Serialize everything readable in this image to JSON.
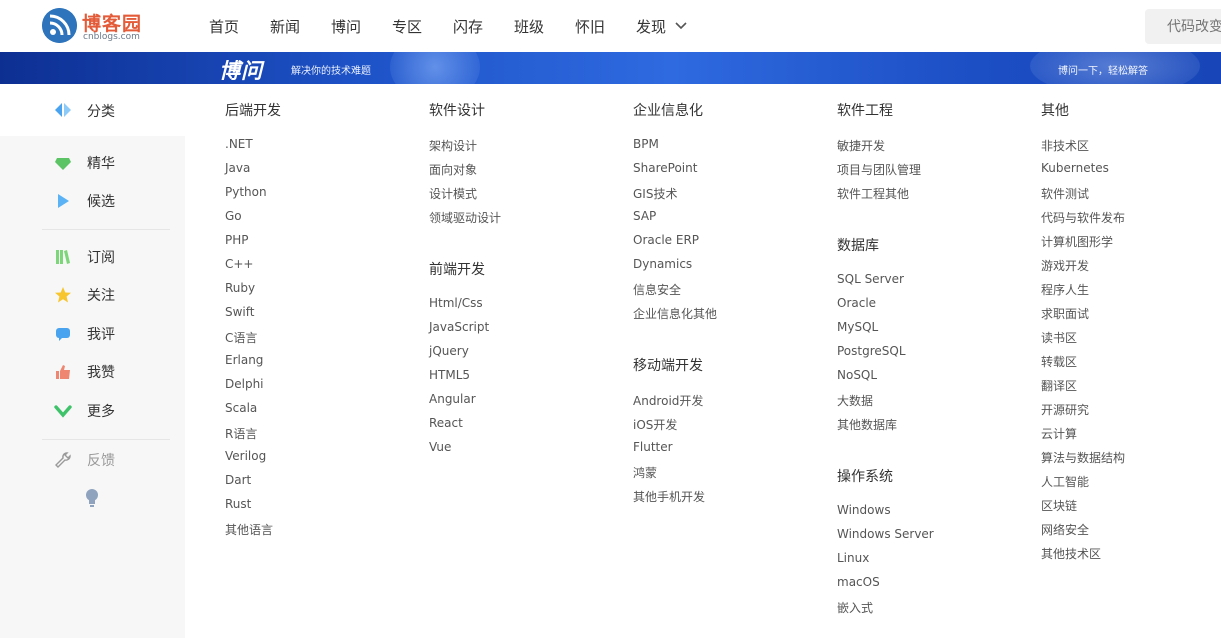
{
  "header": {
    "logo_cn": "博客园",
    "logo_en": "cnblogs.com",
    "nav": [
      "首页",
      "新闻",
      "博问",
      "专区",
      "闪存",
      "班级",
      "怀旧",
      "发现"
    ],
    "search_placeholder": "代码改变世界"
  },
  "banner": {
    "brand": "博问",
    "tagline": "解决你的技术难题",
    "right_text": "博问一下，轻松解答"
  },
  "sidebar": {
    "active": {
      "label": "分类",
      "icon": "category-icon"
    },
    "items": [
      {
        "label": "精华",
        "icon": "gem-icon",
        "color": "#5dc466"
      },
      {
        "label": "候选",
        "icon": "play-icon",
        "color": "#5bb3f5"
      },
      {
        "label": "订阅",
        "icon": "books-icon",
        "color": "#7dd67a"
      },
      {
        "label": "关注",
        "icon": "star-icon",
        "color": "#f7c62f"
      },
      {
        "label": "我评",
        "icon": "comment-icon",
        "color": "#4aa3ee"
      },
      {
        "label": "我赞",
        "icon": "thumbs-up-icon",
        "color": "#ef8671"
      },
      {
        "label": "更多",
        "icon": "chevron-down-icon",
        "color": "#3fc36a"
      }
    ],
    "feedback": {
      "label": "反馈",
      "icon": "wrench-icon"
    },
    "tip_icon": "lightbulb-icon"
  },
  "categories": {
    "backend": {
      "title": "后端开发",
      "items": [
        ".NET",
        "Java",
        "Python",
        "Go",
        "PHP",
        "C++",
        "Ruby",
        "Swift",
        "C语言",
        "Erlang",
        "Delphi",
        "Scala",
        "R语言",
        "Verilog",
        "Dart",
        "Rust",
        "其他语言"
      ]
    },
    "software_design": {
      "title": "软件设计",
      "items": [
        "架构设计",
        "面向对象",
        "设计模式",
        "领域驱动设计"
      ]
    },
    "frontend": {
      "title": "前端开发",
      "items": [
        "Html/Css",
        "JavaScript",
        "jQuery",
        "HTML5",
        "Angular",
        "React",
        "Vue"
      ]
    },
    "enterprise": {
      "title": "企业信息化",
      "items": [
        "BPM",
        "SharePoint",
        "GIS技术",
        "SAP",
        "Oracle ERP",
        "Dynamics",
        "信息安全",
        "企业信息化其他"
      ]
    },
    "mobile": {
      "title": "移动端开发",
      "items": [
        "Android开发",
        "iOS开发",
        "Flutter",
        "鸿蒙",
        "其他手机开发"
      ]
    },
    "software_engineering": {
      "title": "软件工程",
      "items": [
        "敏捷开发",
        "项目与团队管理",
        "软件工程其他"
      ]
    },
    "database": {
      "title": "数据库",
      "items": [
        "SQL Server",
        "Oracle",
        "MySQL",
        "PostgreSQL",
        "NoSQL",
        "大数据",
        "其他数据库"
      ]
    },
    "os": {
      "title": "操作系统",
      "items": [
        "Windows",
        "Windows Server",
        "Linux",
        "macOS",
        "嵌入式"
      ]
    },
    "other": {
      "title": "其他",
      "items": [
        "非技术区",
        "Kubernetes",
        "软件测试",
        "代码与软件发布",
        "计算机图形学",
        "游戏开发",
        "程序人生",
        "求职面试",
        "读书区",
        "转载区",
        "翻译区",
        "开源研究",
        "云计算",
        "算法与数据结构",
        "人工智能",
        "区块链",
        "网络安全",
        "其他技术区"
      ]
    }
  }
}
